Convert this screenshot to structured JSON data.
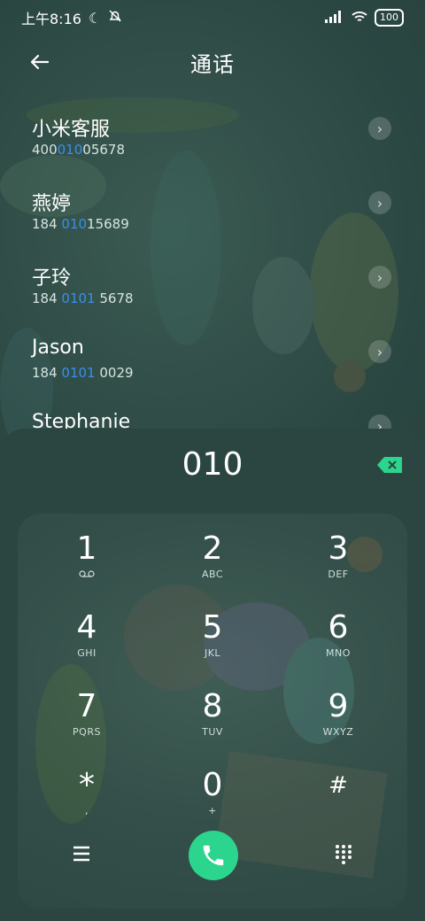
{
  "status_bar": {
    "time": "上午8:16",
    "battery": "100"
  },
  "header": {
    "title": "通话",
    "back_icon": "back-arrow-icon"
  },
  "contacts": [
    {
      "name": "小米客服",
      "number_parts": [
        "400",
        "010",
        "05678"
      ]
    },
    {
      "name": "燕婷",
      "number_parts": [
        "184 ",
        "010",
        "15689"
      ]
    },
    {
      "name": "子玲",
      "number_parts": [
        "184 ",
        "0101",
        " 5678"
      ]
    },
    {
      "name": "Jason",
      "number_parts": [
        "184 ",
        "0101",
        " 0029"
      ]
    },
    {
      "name": "Stephanie",
      "number_parts": [
        "",
        "",
        ""
      ]
    }
  ],
  "dialer": {
    "input": "010",
    "keys": [
      {
        "digit": "1",
        "sub": "voicemail-icon"
      },
      {
        "digit": "2",
        "sub": "ABC"
      },
      {
        "digit": "3",
        "sub": "DEF"
      },
      {
        "digit": "4",
        "sub": "GHI"
      },
      {
        "digit": "5",
        "sub": "JKL"
      },
      {
        "digit": "6",
        "sub": "MNO"
      },
      {
        "digit": "7",
        "sub": "PQRS"
      },
      {
        "digit": "8",
        "sub": "TUV"
      },
      {
        "digit": "9",
        "sub": "WXYZ"
      },
      {
        "digit": "*",
        "sub": ","
      },
      {
        "digit": "0",
        "sub": "+"
      },
      {
        "digit": "#",
        "sub": ""
      }
    ]
  },
  "colors": {
    "accent": "#2bd58d",
    "match_highlight": "#3a8eea",
    "panel": "#2b4641"
  }
}
